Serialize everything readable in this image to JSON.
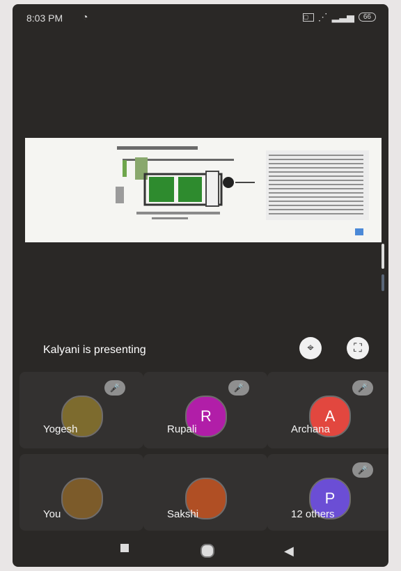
{
  "status": {
    "time": "8:03 PM",
    "battery": "66"
  },
  "presenter": {
    "text": "Kalyani is presenting"
  },
  "participants": [
    {
      "name": "Yogesh",
      "initial": "",
      "color": "#7d6b2e",
      "muted": true
    },
    {
      "name": "Rupali",
      "initial": "R",
      "color": "#b11ea8",
      "muted": true
    },
    {
      "name": "Archana",
      "initial": "A",
      "color": "#e2473f",
      "muted": true
    },
    {
      "name": "You",
      "initial": "",
      "color": "#7c5b2a",
      "muted": false
    },
    {
      "name": "Sakshi",
      "initial": "",
      "color": "#b04f24",
      "muted": false
    },
    {
      "name": "12 others",
      "initial": "P",
      "color": "#6b4ed5",
      "muted": true
    }
  ],
  "icons": {
    "alarm": "alarm-icon",
    "mic_off": "mic-off-icon",
    "pin_off": "pin-off-icon",
    "fullscreen": "fullscreen-icon",
    "nav_back": "back-icon",
    "nav_home": "home-icon",
    "nav_recent": "recent-apps-icon"
  }
}
